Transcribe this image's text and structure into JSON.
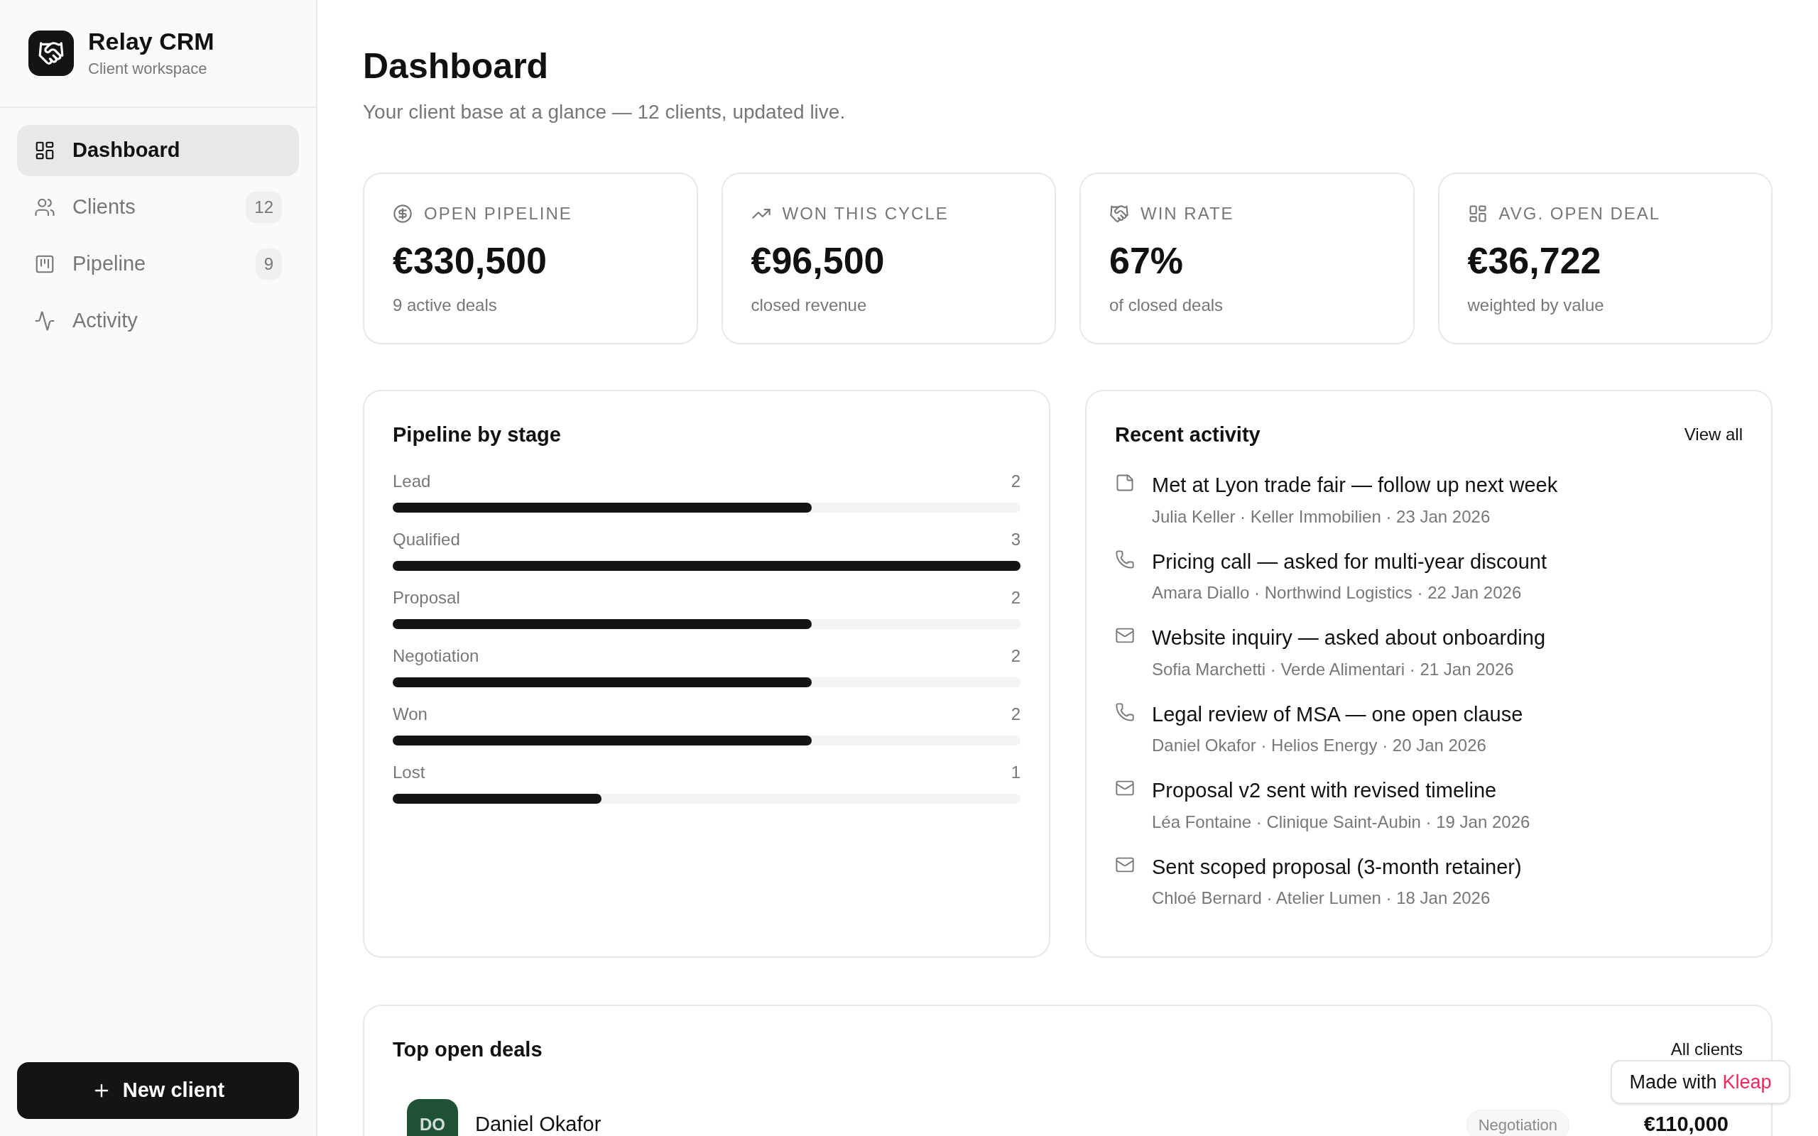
{
  "brand": {
    "name": "Relay CRM",
    "tagline": "Client workspace"
  },
  "sidebar": {
    "items": [
      {
        "label": "Dashboard",
        "kind": "dashboard",
        "selected": true
      },
      {
        "label": "Clients",
        "kind": "clients",
        "selected": false,
        "count": "12"
      },
      {
        "label": "Pipeline",
        "kind": "pipeline",
        "selected": false,
        "count": "9"
      },
      {
        "label": "Activity",
        "kind": "activity",
        "selected": false
      }
    ],
    "new_button": "New client"
  },
  "header": {
    "title": "Dashboard",
    "subtitle": "Your client base at a glance — 12 clients, updated live."
  },
  "stats": [
    {
      "kind": "dollar",
      "label": "OPEN PIPELINE",
      "value": "€330,500",
      "note": "9 active deals"
    },
    {
      "kind": "trend",
      "label": "WON THIS CYCLE",
      "value": "€96,500",
      "note": "closed revenue"
    },
    {
      "kind": "handshake",
      "label": "WIN RATE",
      "value": "67%",
      "note": "of closed deals"
    },
    {
      "kind": "grid",
      "label": "AVG. OPEN DEAL",
      "value": "€36,722",
      "note": "weighted by value"
    }
  ],
  "pipeline": {
    "title": "Pipeline by stage",
    "stages": [
      {
        "name": "Lead",
        "count": "2",
        "level": 0.667
      },
      {
        "name": "Qualified",
        "count": "3",
        "level": 1
      },
      {
        "name": "Proposal",
        "count": "2",
        "level": 0.667
      },
      {
        "name": "Negotiation",
        "count": "2",
        "level": 0.667
      },
      {
        "name": "Won",
        "count": "2",
        "level": 0.667
      },
      {
        "name": "Lost",
        "count": "1",
        "level": 0.333
      }
    ]
  },
  "activity": {
    "title": "Recent activity",
    "link": "View all",
    "items": [
      {
        "kind": "note",
        "text": "Met at Lyon trade fair — follow up next week",
        "meta": "Julia Keller · Keller Immobilien · 23 Jan 2026"
      },
      {
        "kind": "call",
        "text": "Pricing call — asked for multi-year discount",
        "meta": "Amara Diallo · Northwind Logistics · 22 Jan 2026"
      },
      {
        "kind": "email",
        "text": "Website inquiry — asked about onboarding",
        "meta": "Sofia Marchetti · Verde Alimentari · 21 Jan 2026"
      },
      {
        "kind": "call",
        "text": "Legal review of MSA — one open clause",
        "meta": "Daniel Okafor · Helios Energy · 20 Jan 2026"
      },
      {
        "kind": "email",
        "text": "Proposal v2 sent with revised timeline",
        "meta": "Léa Fontaine · Clinique Saint-Aubin · 19 Jan 2026"
      },
      {
        "kind": "email",
        "text": "Sent scoped proposal (3-month retainer)",
        "meta": "Chloé Bernard · Atelier Lumen · 18 Jan 2026"
      }
    ]
  },
  "top_deals": {
    "title": "Top open deals",
    "link": "All clients",
    "rows": [
      {
        "initials": "DO",
        "color": "#1f5135",
        "name": "Daniel Okafor",
        "stage": "Negotiation",
        "amount": "€110,000"
      }
    ]
  },
  "badge": {
    "text": "Made with",
    "brand": "Kleap"
  }
}
